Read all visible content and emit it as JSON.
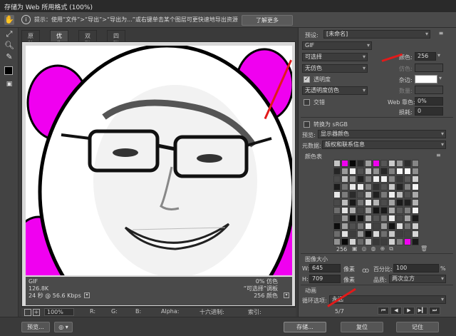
{
  "window": {
    "title": "存储为 Web 所用格式 (100%)"
  },
  "hint": {
    "text": "提示：使用“文件”>“导出”>“导出为...”或右键单击某个图层可更快速地导出资源",
    "learn_more": "了解更多"
  },
  "view_tabs": [
    {
      "label": "原稿",
      "active": false
    },
    {
      "label": "优化",
      "active": true
    },
    {
      "label": "双联",
      "active": false
    },
    {
      "label": "四联",
      "active": false
    }
  ],
  "image_info": {
    "format": "GIF",
    "size": "126.8K",
    "time": "24 秒 @ 56.6 Kbps",
    "dither_pct": "0% 仿色",
    "palette": "“可选择”调板",
    "colors": "256 颜色"
  },
  "status": {
    "zoom": "100%",
    "r": "R:",
    "g": "G:",
    "b": "B:",
    "alpha": "Alpha:",
    "hex": "十六进制:",
    "index": "索引:"
  },
  "bottom": {
    "preview": "预览...",
    "save": "存储...",
    "reset": "复位",
    "remember": "记住"
  },
  "settings": {
    "preset_label": "预设:",
    "preset_value": "[未命名]",
    "format": "GIF",
    "reduction": "可选择",
    "colors_label": "颜色:",
    "colors_value": "256",
    "dither_algo": "无仿色",
    "dither_label": "仿色:",
    "transparency_label": "透明度",
    "transparency_checked": true,
    "matte_label": "杂边:",
    "matte_color": "#ffffff",
    "transp_dither": "无透明度仿色",
    "amount_label": "数量:",
    "interlaced_label": "交错",
    "interlaced_checked": false,
    "websnap_label": "Web 靠色:",
    "websnap_value": "0%",
    "lossy_label": "损耗:",
    "lossy_value": "0",
    "convert_srgb_label": "转换为 sRGB",
    "convert_srgb_checked": false,
    "preview_label": "预览:",
    "preview_value": "显示器颜色",
    "metadata_label": "元数据:",
    "metadata_value": "版权和联系信息",
    "color_table_label": "颜色表",
    "color_count": "256"
  },
  "image_size": {
    "title": "图像大小",
    "w_label": "W:",
    "w_value": "645",
    "h_label": "H:",
    "h_value": "709",
    "unit": "像素",
    "percent_label": "百分比:",
    "percent_value": "100",
    "pct_unit": "%",
    "quality_label": "品质:",
    "quality_value": "两次立方"
  },
  "animation": {
    "title": "动画",
    "loop_label": "循环选项:",
    "loop_value": "永远",
    "frame": "5/7"
  },
  "colors": {
    "magenta": "#f000f0",
    "annotation": "#e21a1a"
  }
}
